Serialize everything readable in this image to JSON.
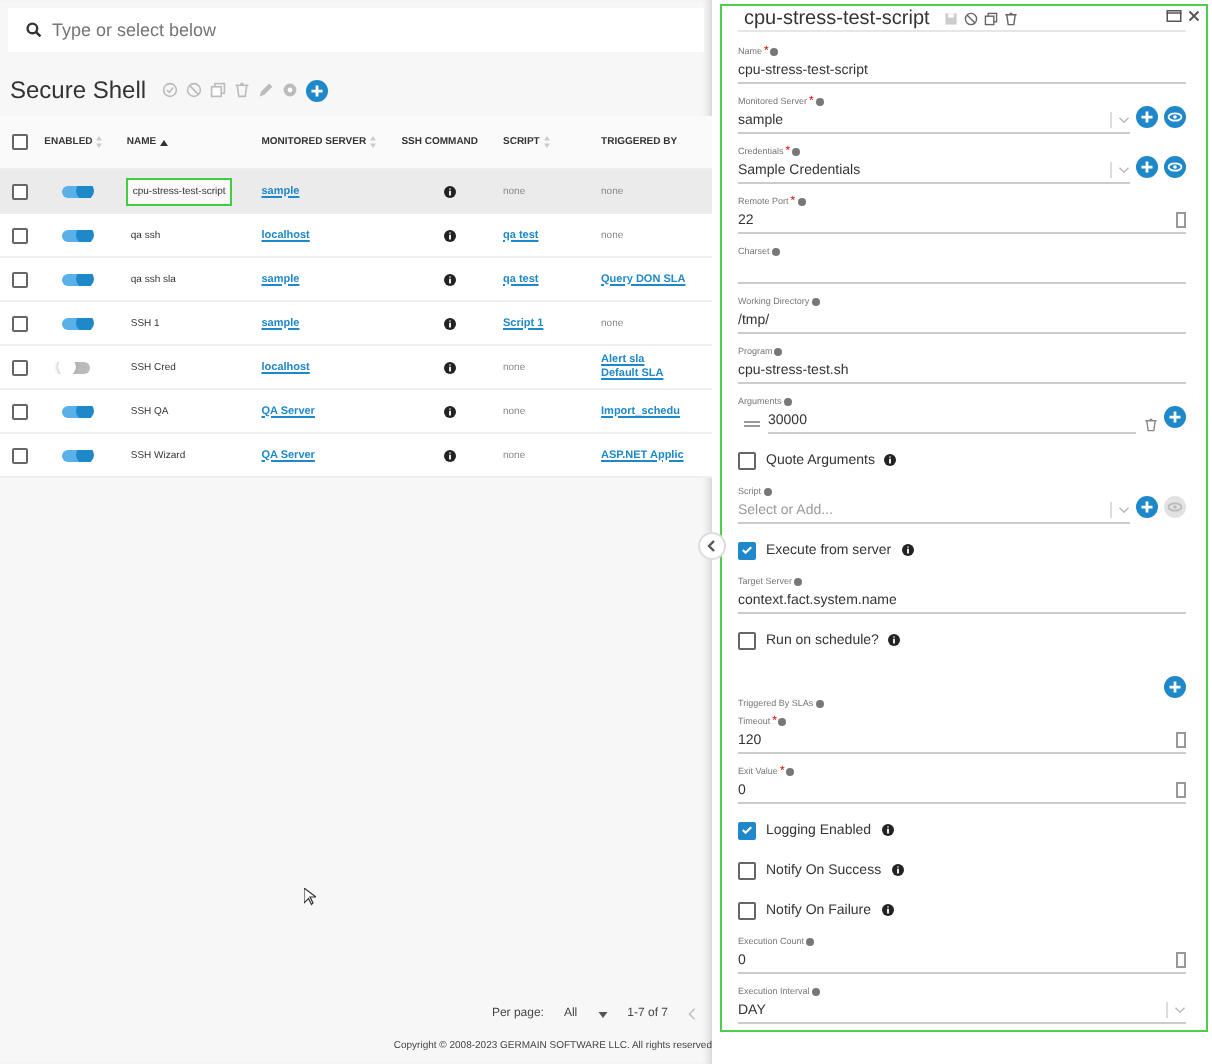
{
  "search": {
    "placeholder": "Type or select below"
  },
  "page": {
    "title": "Secure Shell"
  },
  "table": {
    "select_all_checked": false,
    "columns": [
      {
        "kind": "sortable",
        "label": "ENABLED"
      },
      {
        "kind": "sorted",
        "label": "NAME"
      },
      {
        "kind": "sortable",
        "label": "MONITORED SERVER"
      },
      {
        "kind": "plain",
        "label": "SSH COMMAND"
      },
      {
        "kind": "sortable",
        "label": "SCRIPT"
      },
      {
        "kind": "plain",
        "label": "TRIGGERED BY"
      }
    ],
    "rows": [
      {
        "selected": true,
        "checked": false,
        "enabled": true,
        "name": "cpu-stress-test-script",
        "server": "sample",
        "script": "none",
        "script_link": false,
        "triggered": [
          "none"
        ],
        "triggered_link": false
      },
      {
        "selected": false,
        "checked": false,
        "enabled": true,
        "name": "qa ssh",
        "server": "localhost",
        "script": "qa test",
        "script_link": true,
        "triggered": [
          "none"
        ],
        "triggered_link": false
      },
      {
        "selected": false,
        "checked": false,
        "enabled": true,
        "name": "qa ssh sla",
        "server": "sample",
        "script": "qa test",
        "script_link": true,
        "triggered": [
          "Query DON SLA"
        ],
        "triggered_link": true
      },
      {
        "selected": false,
        "checked": false,
        "enabled": true,
        "name": "SSH 1",
        "server": "sample",
        "script": "Script 1",
        "script_link": true,
        "triggered": [
          "none"
        ],
        "triggered_link": false
      },
      {
        "selected": false,
        "checked": false,
        "enabled": false,
        "name": "SSH Cred",
        "server": "localhost",
        "script": "none",
        "script_link": false,
        "triggered": [
          "Alert sla",
          "Default SLA"
        ],
        "triggered_link": true
      },
      {
        "selected": false,
        "checked": false,
        "enabled": true,
        "name": "SSH QA",
        "server": "QA Server",
        "script": "none",
        "script_link": false,
        "triggered": [
          "Import_schedu"
        ],
        "triggered_link": true
      },
      {
        "selected": false,
        "checked": false,
        "enabled": true,
        "name": "SSH Wizard",
        "server": "QA Server",
        "script": "none",
        "script_link": false,
        "triggered": [
          "ASP.NET Applic"
        ],
        "triggered_link": true
      }
    ]
  },
  "pager": {
    "label": "Per page:",
    "value": "All",
    "range": "1-7 of 7"
  },
  "footer": "Copyright © 2008-2023 GERMAIN SOFTWARE LLC. All rights reserved",
  "panel": {
    "title": "cpu-stress-test-script",
    "fields": [
      {
        "kind": "text",
        "label": "Name",
        "required_mark": "*",
        "value": "cpu-stress-test-script"
      },
      {
        "kind": "select",
        "label": "Monitored Server",
        "required_mark": "*",
        "value": "sample",
        "actions": true,
        "view_enabled": true
      },
      {
        "kind": "select",
        "label": "Credentials",
        "required_mark": "*",
        "value": "Sample Credentials",
        "actions": true,
        "view_enabled": true
      },
      {
        "kind": "number",
        "label": "Remote Port",
        "required_mark": "*",
        "value": "22"
      },
      {
        "kind": "text",
        "label": "Charset"
      },
      {
        "kind": "text",
        "label": "Working Directory",
        "value": "/tmp/"
      },
      {
        "kind": "text",
        "label": "Program",
        "value": "cpu-stress-test.sh"
      },
      {
        "kind": "args",
        "label": "Arguments",
        "values": [
          "30000"
        ]
      },
      {
        "kind": "checkbox",
        "label": "Quote Arguments",
        "checked": false
      },
      {
        "kind": "select",
        "label": "Script",
        "placeholder": "Select or Add...",
        "actions": true,
        "view_enabled": false
      },
      {
        "kind": "checkbox",
        "label": "Execute from server",
        "checked": true
      },
      {
        "kind": "text",
        "label": "Target Server",
        "value": "context.fact.system.name"
      },
      {
        "kind": "checkbox",
        "label": "Run on schedule?",
        "checked": false
      },
      {
        "kind": "list",
        "label": "Triggered By SLAs"
      },
      {
        "kind": "number",
        "label": "Timeout",
        "required_mark": "*",
        "value": "120"
      },
      {
        "kind": "number",
        "label": "Exit Value",
        "required_mark": "*",
        "value": "0"
      },
      {
        "kind": "checkbox",
        "label": "Logging Enabled",
        "checked": true
      },
      {
        "kind": "checkbox",
        "label": "Notify On Success",
        "checked": false
      },
      {
        "kind": "checkbox",
        "label": "Notify On Failure",
        "checked": false
      },
      {
        "kind": "number",
        "label": "Execution Count",
        "value": "0"
      },
      {
        "kind": "select",
        "label": "Execution Interval",
        "value": "DAY",
        "actions": false
      }
    ]
  }
}
